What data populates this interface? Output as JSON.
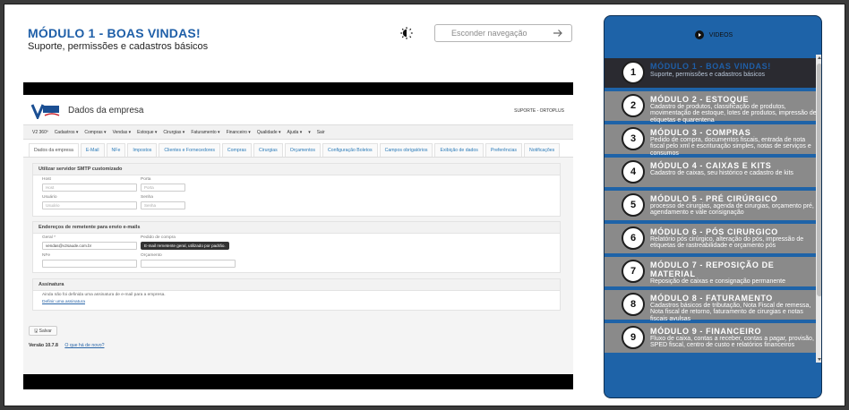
{
  "header": {
    "title": "MÓDULO 1 - BOAS VINDAS!",
    "subtitle": "Suporte, permissões e cadastros básicos",
    "hide_nav_label": "Esconder navegação"
  },
  "video": {
    "page_title": "Dados da empresa",
    "user": "SUPORTE - ORTOPLUS",
    "logo_text": "V2",
    "menu": [
      "V2 360º",
      "Cadastros ▾",
      "Compras ▾",
      "Vendas ▾",
      "Estoque ▾",
      "Cirurgias ▾",
      "Faturamento ▾",
      "Financeiro ▾",
      "Qualidade ▾",
      "Ajuda ▾",
      "▾",
      "Sair"
    ],
    "tabs": [
      "Dados da empresa",
      "E-Mail",
      "NFe",
      "Impostos",
      "Clientes e Fornecedores",
      "Compras",
      "Cirurgias",
      "Orçamentos",
      "Configuração Boletos",
      "Campos obrigatórios",
      "Exibição de dados",
      "Preferências",
      "Notificações"
    ],
    "smtp": {
      "title": "Utilizar servidor SMTP customizado",
      "host_label": "Host",
      "host_placeholder": "Host",
      "porta_label": "Porta",
      "porta_placeholder": "Porta",
      "usuario_label": "Usuário",
      "usuario_placeholder": "Usuário",
      "senha_label": "Senha",
      "senha_placeholder": "Senha"
    },
    "remetente": {
      "title": "Endereços de remetente para envio e-mails",
      "geral_label": "Geral *",
      "geral_value": "vendas@v2saude.com.br",
      "pedido_label": "Pedido de compra",
      "tooltip": "E-mail remetente geral, utilizado por padrão.",
      "nfe_label": "NFe",
      "orc_label": "Orçamento"
    },
    "assinatura": {
      "title": "Assinatura",
      "text": "Ainda não foi definida uma assinatura de e-mail para a empresa.",
      "link": "Definir uma assinatura"
    },
    "save_label": "Salvar",
    "version_label": "Versão 10.7.8",
    "whats_new": "O que há de novo?"
  },
  "sidebar": {
    "header": "VIDEOS",
    "items": [
      {
        "num": "1",
        "title": "MÓDULO 1 - BOAS VINDAS!",
        "desc": "Suporte, permissões e cadastros básicos"
      },
      {
        "num": "2",
        "title": "MÓDULO 2 - ESTOQUE",
        "desc": "Cadastro de produtos, classificação de produtos, movimentação de estoque, lotes de produtos, impressão de etiquetas e quarentena"
      },
      {
        "num": "3",
        "title": "MÓDULO 3 - COMPRAS",
        "desc": "Pedido de compra, documentos fiscais, entrada de nota fiscal pelo xml e escrituração simples, notas de serviços e consumos"
      },
      {
        "num": "4",
        "title": "MÓDULO 4 - CAIXAS E KITS",
        "desc": "Cadastro de caixas, seu histórico e cadastro de kits"
      },
      {
        "num": "5",
        "title": "MÓDULO 5 - PRÉ CIRÚRGICO",
        "desc": "processo de cirurgias, agenda de cirurgias, orçamento pré, agendamento e vale consignação"
      },
      {
        "num": "6",
        "title": "MÓDULO 6 - PÓS CIRURGICO",
        "desc": "Relatório pós cirúrgico, alteração do pós, impressão de etiquetas de rastreabilidade e orçamento pós"
      },
      {
        "num": "7",
        "title": "MÓDULO 7 - REPOSIÇÃO DE MATERIAL",
        "desc": "Reposição de caixas e consignação permanente"
      },
      {
        "num": "8",
        "title": "MÓDULO 8 - FATURAMENTO",
        "desc": "Cadastros básicos de tributação, Nota Fiscal de remessa, Nota fiscal de retorno, faturamento de cirurgias e notas fiscais avulsas"
      },
      {
        "num": "9",
        "title": "MÓDULO 9 - FINANCEIRO",
        "desc": "Fluxo de caixa, contas a receber, contas a pagar, provisão, SPED fiscal, centro de custo e relatórios financeiros"
      }
    ]
  }
}
